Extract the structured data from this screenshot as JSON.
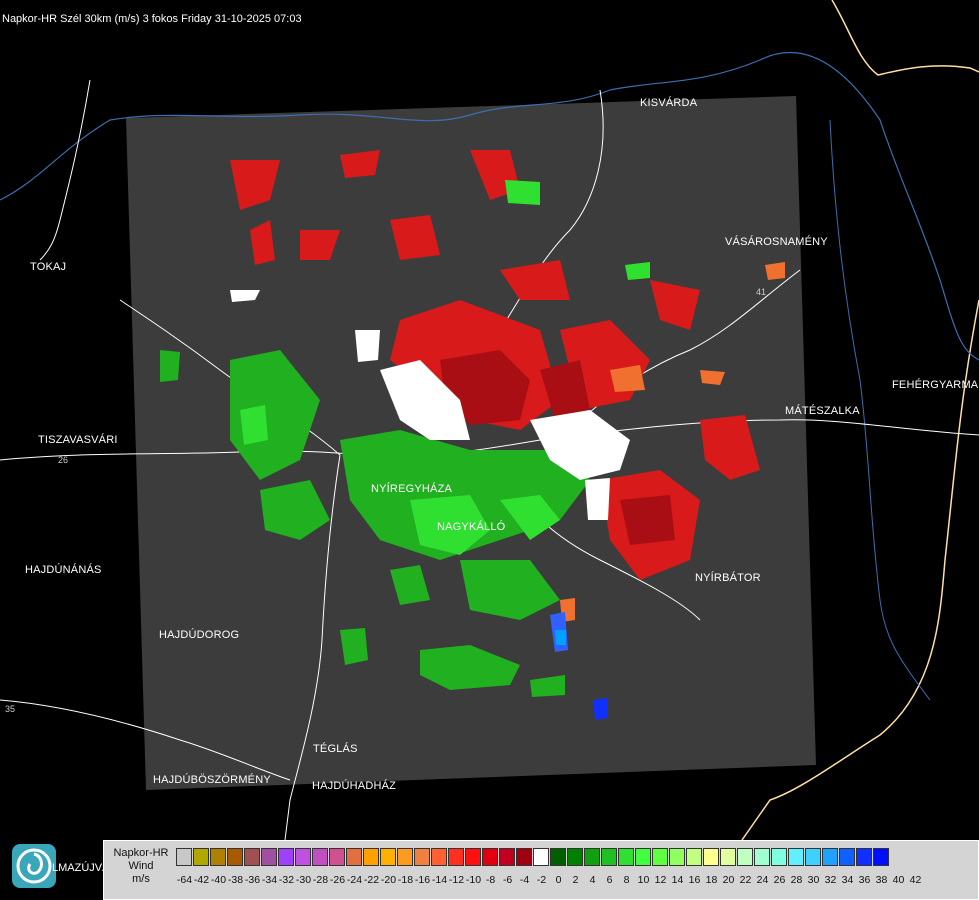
{
  "header": {
    "title": "Napkor-HR Szél 30km (m/s) 3 fokos Friday 31-10-2025 07:03"
  },
  "cities": [
    {
      "id": "kisvarda",
      "name": "KISVÁRDA"
    },
    {
      "id": "vasarosnameny",
      "name": "VÁSÁROSNAMÉNY"
    },
    {
      "id": "tokaj",
      "name": "TOKAJ"
    },
    {
      "id": "fehergyarmat",
      "name": "FEHÉRGYARMA"
    },
    {
      "id": "mateszalka",
      "name": "MÁTÉSZALKA"
    },
    {
      "id": "tiszavasvari",
      "name": "TISZAVASVÁRI"
    },
    {
      "id": "nyiregyhaza",
      "name": "NYÍREGYHÁZA"
    },
    {
      "id": "nagykallo",
      "name": "NAGYKÁLLÓ"
    },
    {
      "id": "hajdunanas",
      "name": "HAJDÚNÁNÁS"
    },
    {
      "id": "nyirbator",
      "name": "NYÍRBÁTOR"
    },
    {
      "id": "hajdudorog",
      "name": "HAJDÚDOROG"
    },
    {
      "id": "teglas",
      "name": "TÉGLÁS"
    },
    {
      "id": "hajduboszormeny",
      "name": "HAJDÚBÖSZÖRMÉNY"
    },
    {
      "id": "hajduhadhaz",
      "name": "HAJDÚHADHÁZ"
    }
  ],
  "road_labels": [
    "26",
    "35",
    "41"
  ],
  "logo_partial_text": "LMAZÚJVÁR",
  "legend": {
    "title_line1": "Napkor-HR",
    "title_line2": "Wind",
    "title_line3": "m/s",
    "ticks": [
      "-64",
      "-42",
      "-40",
      "-38",
      "-36",
      "-34",
      "-32",
      "-30",
      "-28",
      "-26",
      "-24",
      "-22",
      "-20",
      "-18",
      "-16",
      "-14",
      "-12",
      "-10",
      "-8",
      "-6",
      "-4",
      "-2",
      "0",
      "2",
      "4",
      "6",
      "8",
      "10",
      "12",
      "14",
      "16",
      "18",
      "20",
      "22",
      "24",
      "26",
      "28",
      "30",
      "32",
      "34",
      "36",
      "38",
      "40",
      "42"
    ],
    "colors": [
      "#c8c8c8",
      "#b0a800",
      "#b08000",
      "#a85a00",
      "#a05050",
      "#a050a0",
      "#a040ff",
      "#c050e0",
      "#c050c0",
      "#d05090",
      "#e07040",
      "#ffa000",
      "#ffb000",
      "#ff9a20",
      "#f08040",
      "#ff6030",
      "#ff3020",
      "#ff1010",
      "#e00010",
      "#c00020",
      "#a00010",
      "#ffffff",
      "#006000",
      "#008000",
      "#10a010",
      "#20c020",
      "#30e030",
      "#40ff40",
      "#60ff40",
      "#90ff60",
      "#c0ff80",
      "#ffff90",
      "#e0ffa0",
      "#c0ffc0",
      "#a0ffd0",
      "#80ffe0",
      "#60f0ff",
      "#40d0ff",
      "#20a0ff",
      "#1060ff",
      "#1030ff",
      "#0010ff"
    ]
  },
  "colors": {
    "radar_area": "#3c3c3c",
    "background": "#000000",
    "border_line": "#ffffff",
    "river_line": "#3b6fb0",
    "country_border": "#ffe0a0"
  }
}
